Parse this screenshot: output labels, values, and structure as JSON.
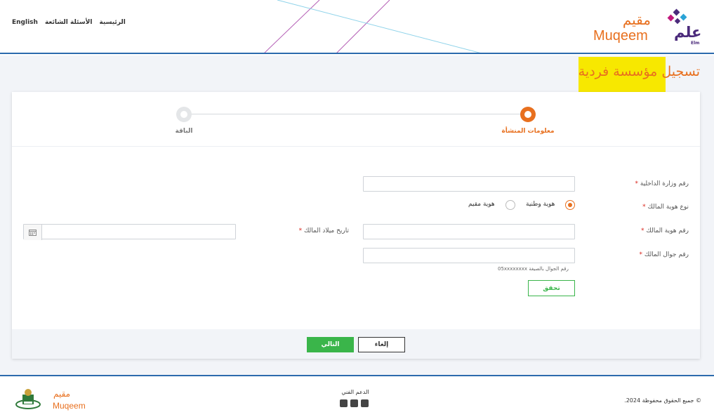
{
  "header": {
    "nav": [
      "English",
      "الأسئلة الشائعة",
      "الرئيسية"
    ],
    "logo_muqeem_ar": "مقيم",
    "logo_muqeem_en": "Muqeem",
    "logo_elm_ar": "علم",
    "logo_elm_en": "Elm"
  },
  "page": {
    "title": "تسجيل مؤسسة فردية"
  },
  "steps": [
    {
      "label": "معلومات المنشأة",
      "state": "active"
    },
    {
      "label": "الباقة",
      "state": "inactive"
    }
  ],
  "form": {
    "moi_number_label": "رقم وزارة الداخلية",
    "owner_id_type_label": "نوع هوية المالك",
    "id_type_options": [
      {
        "label": "هوية وطنية",
        "selected": true
      },
      {
        "label": "هوية مقيم",
        "selected": false
      }
    ],
    "owner_id_label": "رقم هوية المالك",
    "owner_birth_label": "تاريخ ميلاد المالك",
    "owner_mobile_label": "رقم جوال المالك",
    "mobile_hint": "رقم الجوال بالصيغة 05xxxxxxxx",
    "required_mark": "*",
    "verify_button": "تحقق"
  },
  "actions": {
    "cancel": "إلغاء",
    "next": "التالي"
  },
  "footer": {
    "brand_ar": "مقيم",
    "brand_en": "Muqeem",
    "support": "الدعم الفني",
    "copyright": "© جميع الحقوق محفوظة 2024."
  },
  "colors": {
    "accent": "#e8701f",
    "green": "#3ab54a",
    "blue": "#2c6aad",
    "highlight": "#f7e800"
  }
}
